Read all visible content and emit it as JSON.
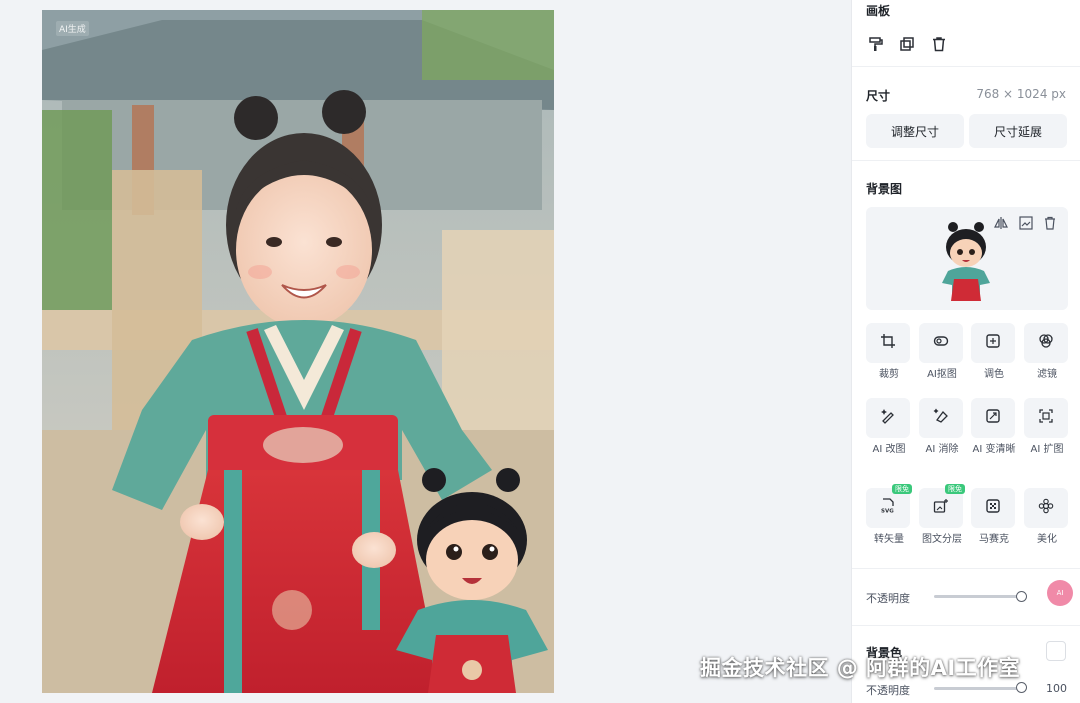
{
  "canvas": {
    "ai_tag": "AI生成"
  },
  "panel": {
    "artboard_title": "画板",
    "artboard_tools": [
      "format-brush-icon",
      "duplicate-icon",
      "trash-icon"
    ],
    "size_title": "尺寸",
    "size_value": "768 × 1024 px",
    "resize_button": "调整尺寸",
    "extend_button": "尺寸延展",
    "bg_image_title": "背景图",
    "bg_preview_tools": [
      "flip-icon",
      "replace-image-icon",
      "trash-icon"
    ],
    "tools": [
      {
        "label": "裁剪",
        "icon": "crop-icon"
      },
      {
        "label": "AI抠图",
        "icon": "cutout-icon"
      },
      {
        "label": "调色",
        "icon": "adjust-color-icon"
      },
      {
        "label": "滤镜",
        "icon": "filter-icon"
      },
      {
        "label": "AI 改图",
        "icon": "ai-edit-icon"
      },
      {
        "label": "AI 消除",
        "icon": "ai-erase-icon"
      },
      {
        "label": "AI 变清晰",
        "icon": "ai-sharpen-icon"
      },
      {
        "label": "AI 扩图",
        "icon": "ai-expand-icon"
      },
      {
        "label": "转矢量",
        "icon": "svg-icon",
        "badge": "限免",
        "icon_text": "SVG"
      },
      {
        "label": "图文分层",
        "icon": "layer-split-icon",
        "badge": "限免"
      },
      {
        "label": "马赛克",
        "icon": "mosaic-icon"
      },
      {
        "label": "美化",
        "icon": "beautify-icon"
      }
    ],
    "opacity_label": "不透明度",
    "opacity_level": 1.0,
    "bg_color_title": "背景色",
    "bg_opacity_label": "不透明度",
    "bg_opacity_value": "100",
    "float_avatar_text": "AI"
  },
  "watermark": "掘金技术社区 @ 阿群的AI工作室"
}
